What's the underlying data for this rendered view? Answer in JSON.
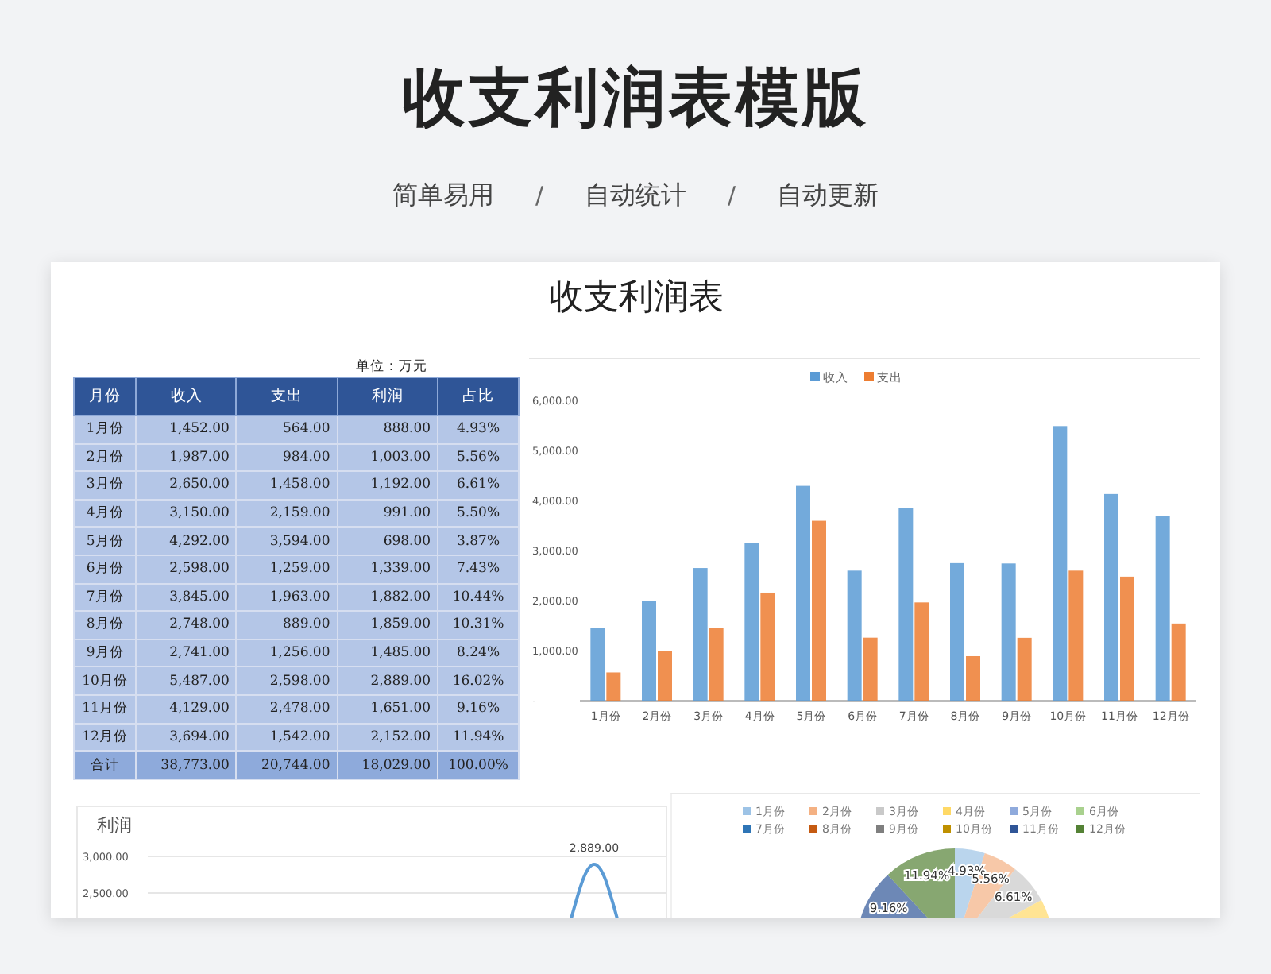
{
  "header": {
    "title": "收支利润表模版",
    "tags": [
      {
        "kind": "tag",
        "text": "简单易用"
      },
      {
        "kind": "separator",
        "text": "/"
      },
      {
        "kind": "tag",
        "text": "自动统计"
      },
      {
        "kind": "separator",
        "text": "/"
      },
      {
        "kind": "tag",
        "text": "自动更新"
      }
    ]
  },
  "sheet": {
    "title": "收支利润表",
    "unit": "单位：万元",
    "table": {
      "columns": [
        "月份",
        "收入",
        "支出",
        "利润",
        "占比"
      ],
      "rows": [
        [
          "1月份",
          "1,452.00",
          "564.00",
          "888.00",
          "4.93%"
        ],
        [
          "2月份",
          "1,987.00",
          "984.00",
          "1,003.00",
          "5.56%"
        ],
        [
          "3月份",
          "2,650.00",
          "1,458.00",
          "1,192.00",
          "6.61%"
        ],
        [
          "4月份",
          "3,150.00",
          "2,159.00",
          "991.00",
          "5.50%"
        ],
        [
          "5月份",
          "4,292.00",
          "3,594.00",
          "698.00",
          "3.87%"
        ],
        [
          "6月份",
          "2,598.00",
          "1,259.00",
          "1,339.00",
          "7.43%"
        ],
        [
          "7月份",
          "3,845.00",
          "1,963.00",
          "1,882.00",
          "10.44%"
        ],
        [
          "8月份",
          "2,748.00",
          "889.00",
          "1,859.00",
          "10.31%"
        ],
        [
          "9月份",
          "2,741.00",
          "1,256.00",
          "1,485.00",
          "8.24%"
        ],
        [
          "10月份",
          "5,487.00",
          "2,598.00",
          "2,889.00",
          "16.02%"
        ],
        [
          "11月份",
          "4,129.00",
          "2,478.00",
          "1,651.00",
          "9.16%"
        ],
        [
          "12月份",
          "3,694.00",
          "1,542.00",
          "2,152.00",
          "11.94%"
        ]
      ],
      "total": [
        "合计",
        "38,773.00",
        "20,744.00",
        "18,029.00",
        "100.00%"
      ]
    },
    "bar_chart": {
      "chart_data": {
        "type": "bar",
        "legend": "top",
        "categories": [
          "1月份",
          "2月份",
          "3月份",
          "4月份",
          "5月份",
          "6月份",
          "7月份",
          "8月份",
          "9月份",
          "10月份",
          "11月份",
          "12月份"
        ],
        "series": [
          {
            "name": "收入",
            "color": "#5b9bd5",
            "values": [
              1452,
              1987,
              2650,
              3150,
              4292,
              2598,
              3845,
              2748,
              2741,
              5487,
              4129,
              3694
            ]
          },
          {
            "name": "支出",
            "color": "#ed7d31",
            "values": [
              564,
              984,
              1458,
              2159,
              3594,
              1259,
              1963,
              889,
              1256,
              2598,
              2478,
              1542
            ]
          }
        ],
        "ylim": [
          0,
          6000
        ],
        "yticks": [
          {
            "value": 0,
            "label": "-"
          },
          {
            "value": 1000,
            "label": "1,000.00"
          },
          {
            "value": 2000,
            "label": "2,000.00"
          },
          {
            "value": 3000,
            "label": "3,000.00"
          },
          {
            "value": 4000,
            "label": "4,000.00"
          },
          {
            "value": 5000,
            "label": "5,000.00"
          },
          {
            "value": 6000,
            "label": "6,000.00"
          }
        ]
      }
    },
    "line_chart": {
      "title": "利润",
      "tick_labels": [
        "3,000.00",
        "2,500.00"
      ],
      "peak_label": "2,889.00"
    },
    "pie_chart": {
      "legend": [
        {
          "label": "1月份",
          "color": "#9dc3e6",
          "slice_label": "4.93%"
        },
        {
          "label": "2月份",
          "color": "#f4b183",
          "slice_label": "5.56%"
        },
        {
          "label": "3月份",
          "color": "#c9c9c9",
          "slice_label": "6.61%"
        },
        {
          "label": "4月份",
          "color": "#ffd966"
        },
        {
          "label": "5月份",
          "color": "#8faadc"
        },
        {
          "label": "6月份",
          "color": "#a9d18e"
        },
        {
          "label": "7月份",
          "color": "#2e75b6"
        },
        {
          "label": "8月份",
          "color": "#c55a11"
        },
        {
          "label": "9月份",
          "color": "#7f7f7f"
        },
        {
          "label": "10月份",
          "color": "#bf9000"
        },
        {
          "label": "11月份",
          "color": "#2f5597",
          "slice_label": "9.16%"
        },
        {
          "label": "12月份",
          "color": "#548235",
          "slice_label": "11.94%"
        }
      ]
    }
  }
}
